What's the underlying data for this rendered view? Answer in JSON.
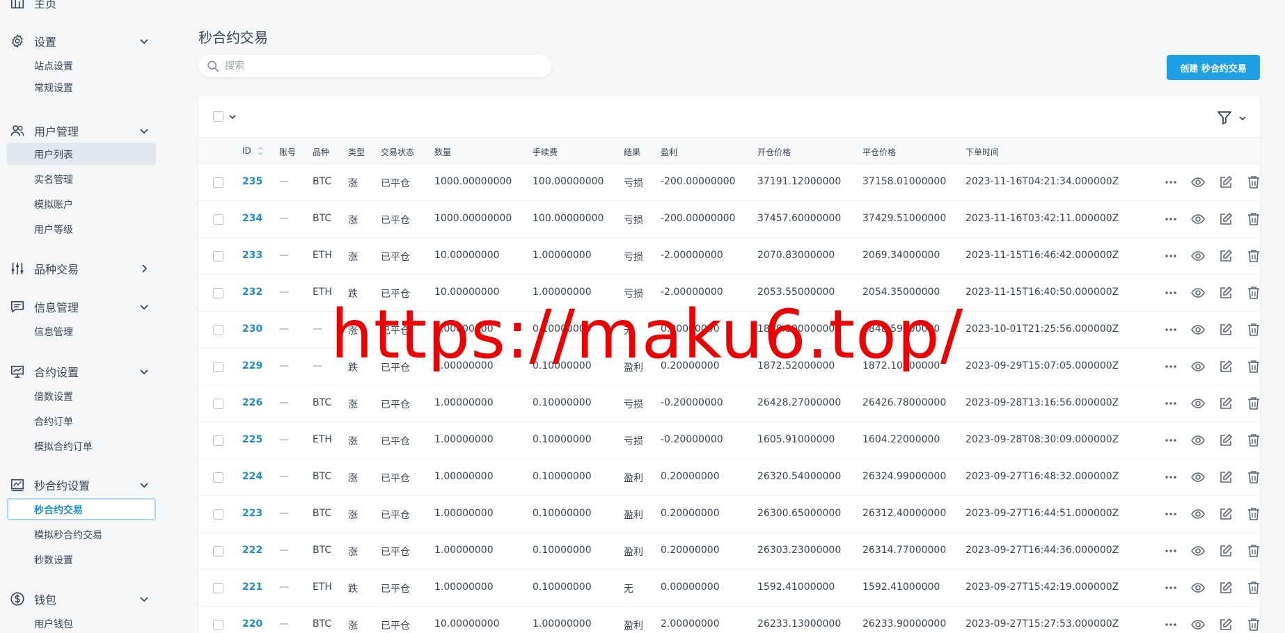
{
  "sidebar": {
    "groups": [
      {
        "label": "主页",
        "icon": "home-chart-icon"
      },
      {
        "label": "设置",
        "icon": "gear-icon",
        "items": [
          "站点设置",
          "常规设置"
        ]
      },
      {
        "label": "用户管理",
        "icon": "users-icon",
        "items": [
          "用户列表",
          "实名管理",
          "模拟账户",
          "用户等级"
        ]
      },
      {
        "label": "品种交易",
        "icon": "sliders-icon"
      },
      {
        "label": "信息管理",
        "icon": "message-icon",
        "items": [
          "信息管理"
        ]
      },
      {
        "label": "合约设置",
        "icon": "presentation-icon",
        "items": [
          "倍数设置",
          "合约订单",
          "模拟合约订单"
        ]
      },
      {
        "label": "秒合约设置",
        "icon": "chart-line-icon",
        "items": [
          "秒合约交易",
          "模拟秒合约交易",
          "秒数设置"
        ]
      },
      {
        "label": "钱包",
        "icon": "dollar-icon",
        "items": [
          "用户钱包"
        ]
      }
    ]
  },
  "main": {
    "title": "秒合约交易",
    "search_placeholder": "搜索",
    "create_button": "创建 秒合约交易"
  },
  "table": {
    "columns": [
      "ID",
      "账号",
      "品种",
      "类型",
      "交易状态",
      "数量",
      "手续费",
      "结果",
      "盈利",
      "开仓价格",
      "平仓价格",
      "下单时间"
    ],
    "rows": [
      [
        "235",
        "—",
        "BTC",
        "涨",
        "已平仓",
        "1000.00000000",
        "100.00000000",
        "亏损",
        "-200.00000000",
        "37191.12000000",
        "37158.01000000",
        "2023-11-16T04:21:34.000000Z"
      ],
      [
        "234",
        "—",
        "BTC",
        "涨",
        "已平仓",
        "1000.00000000",
        "100.00000000",
        "亏损",
        "-200.00000000",
        "37457.60000000",
        "37429.51000000",
        "2023-11-16T03:42:11.000000Z"
      ],
      [
        "233",
        "—",
        "ETH",
        "涨",
        "已平仓",
        "10.00000000",
        "1.00000000",
        "亏损",
        "-2.00000000",
        "2070.83000000",
        "2069.34000000",
        "2023-11-15T16:46:42.000000Z"
      ],
      [
        "232",
        "—",
        "ETH",
        "跌",
        "已平仓",
        "10.00000000",
        "1.00000000",
        "亏损",
        "-2.00000000",
        "2053.55000000",
        "2054.35000000",
        "2023-11-15T16:40:50.000000Z"
      ],
      [
        "230",
        "—",
        "—",
        "涨",
        "已平仓",
        "1.00000000",
        "0.10000000",
        "无",
        "0.00000000",
        "1848.59000000",
        "1848.59000000",
        "2023-10-01T21:25:56.000000Z"
      ],
      [
        "229",
        "—",
        "—",
        "跌",
        "已平仓",
        "1.00000000",
        "0.10000000",
        "盈利",
        "0.20000000",
        "1872.52000000",
        "1872.10000000",
        "2023-09-29T15:07:05.000000Z"
      ],
      [
        "226",
        "—",
        "BTC",
        "涨",
        "已平仓",
        "1.00000000",
        "0.10000000",
        "亏损",
        "-0.20000000",
        "26428.27000000",
        "26426.78000000",
        "2023-09-28T13:16:56.000000Z"
      ],
      [
        "225",
        "—",
        "ETH",
        "涨",
        "已平仓",
        "1.00000000",
        "0.10000000",
        "亏损",
        "-0.20000000",
        "1605.91000000",
        "1604.22000000",
        "2023-09-28T08:30:09.000000Z"
      ],
      [
        "224",
        "—",
        "BTC",
        "涨",
        "已平仓",
        "1.00000000",
        "0.10000000",
        "盈利",
        "0.20000000",
        "26320.54000000",
        "26324.99000000",
        "2023-09-27T16:48:32.000000Z"
      ],
      [
        "223",
        "—",
        "BTC",
        "涨",
        "已平仓",
        "1.00000000",
        "0.10000000",
        "盈利",
        "0.20000000",
        "26300.65000000",
        "26312.40000000",
        "2023-09-27T16:44:51.000000Z"
      ],
      [
        "222",
        "—",
        "BTC",
        "涨",
        "已平仓",
        "1.00000000",
        "0.10000000",
        "盈利",
        "0.20000000",
        "26303.23000000",
        "26314.77000000",
        "2023-09-27T16:44:36.000000Z"
      ],
      [
        "221",
        "—",
        "ETH",
        "跌",
        "已平仓",
        "1.00000000",
        "0.10000000",
        "无",
        "0.00000000",
        "1592.41000000",
        "1592.41000000",
        "2023-09-27T15:42:19.000000Z"
      ],
      [
        "220",
        "—",
        "BTC",
        "涨",
        "已平仓",
        "10.00000000",
        "1.00000000",
        "盈利",
        "2.00000000",
        "26233.13000000",
        "26233.90000000",
        "2023-09-27T15:27:53.000000Z"
      ]
    ]
  },
  "watermark": "https://maku6.top/",
  "colors": {
    "accent": "#1ea0e6",
    "link": "#1c8dd3",
    "watermark": "#ee0000"
  }
}
